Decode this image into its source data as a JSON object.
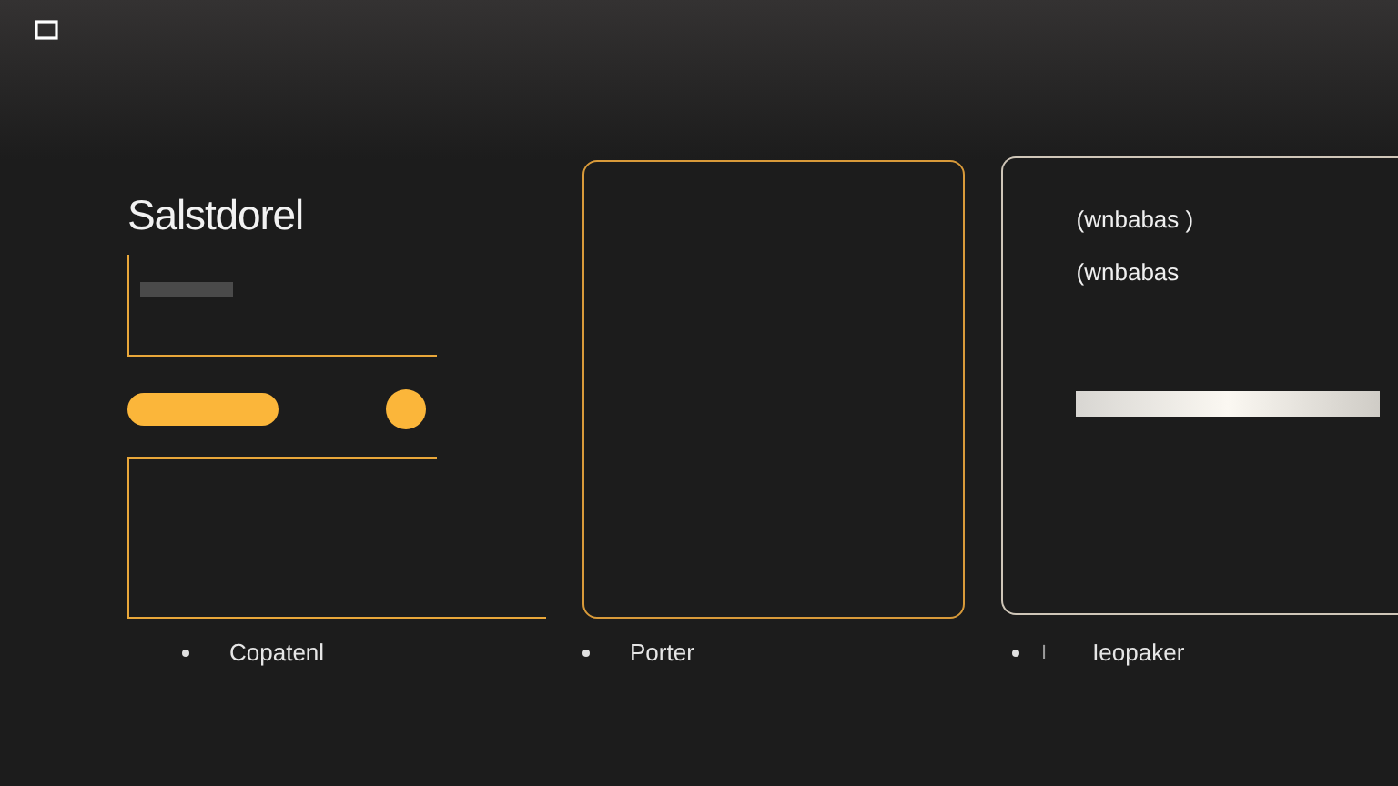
{
  "left_panel": {
    "title": "Salstdorel"
  },
  "right_panel": {
    "lines": [
      "(wnbabas )",
      "(wnbabas"
    ]
  },
  "legend": [
    {
      "label": "Copatenl"
    },
    {
      "label": "Porter"
    },
    {
      "label": "Ieopaker",
      "tag": "I"
    }
  ]
}
